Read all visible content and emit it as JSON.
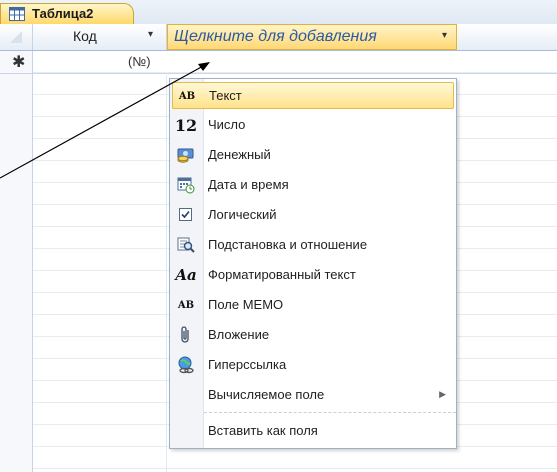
{
  "tab": {
    "label": "Таблица2",
    "icon": "table-icon"
  },
  "header": {
    "column_kod": "Код",
    "column_kod_arrow": "▾",
    "add_column": "Щелкните для добавления",
    "add_column_arrow": "▾"
  },
  "new_row": {
    "marker": "✱",
    "value": "(№)"
  },
  "menu": {
    "items": [
      {
        "label": "Текст",
        "icon": "text-ab-icon",
        "icon_glyph": "AB"
      },
      {
        "label": "Число",
        "icon": "number-icon",
        "icon_glyph": "12"
      },
      {
        "label": "Денежный",
        "icon": "currency-icon",
        "icon_glyph": ""
      },
      {
        "label": "Дата и время",
        "icon": "calendar-icon",
        "icon_glyph": ""
      },
      {
        "label": "Логический",
        "icon": "checkbox-icon",
        "icon_glyph": ""
      },
      {
        "label": "Подстановка и отношение",
        "icon": "lookup-icon",
        "icon_glyph": ""
      },
      {
        "label": "Форматированный текст",
        "icon": "rich-text-icon",
        "icon_glyph": "Aa"
      },
      {
        "label": "Поле MEMO",
        "icon": "memo-icon",
        "icon_glyph": "AB"
      },
      {
        "label": "Вложение",
        "icon": "paperclip-icon",
        "icon_glyph": ""
      },
      {
        "label": "Гиперссылка",
        "icon": "hyperlink-icon",
        "icon_glyph": ""
      },
      {
        "label": "Вычисляемое поле",
        "icon": "calculated-icon",
        "icon_glyph": "",
        "submenu_arrow": "▶"
      },
      {
        "label": "Вставить как поля",
        "icon": "",
        "icon_glyph": ""
      }
    ],
    "selected_index": 0
  },
  "colors": {
    "accent_tab": "#ffd86a",
    "selected_item": "#ffe28a",
    "header_blue": "#2b5aa0"
  }
}
